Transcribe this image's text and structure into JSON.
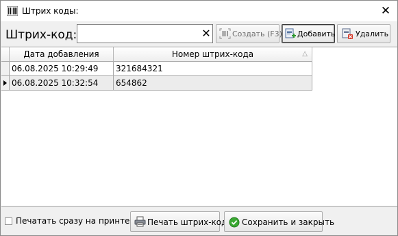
{
  "window": {
    "title": "Штрих коды:",
    "close_glyph": "✕",
    "icon": "barcode-icon"
  },
  "toolbar": {
    "barcode_label": "Штрих-код:",
    "barcode_value": "",
    "clear_glyph": "✕",
    "create_label": "Создать (F3)",
    "add_label": "Добавить",
    "delete_label": "Удалить",
    "create_enabled": false
  },
  "grid": {
    "columns": [
      "Дата добавления",
      "Номер штрих-кода"
    ],
    "sort_glyph": "△",
    "rows": [
      {
        "date": "06.08.2025 10:29:49",
        "number": "321684321",
        "current": false
      },
      {
        "date": "06.08.2025 10:32:54",
        "number": "654862",
        "current": true
      }
    ]
  },
  "footer": {
    "print_immediately_label": "Печатать сразу на принтер",
    "print_immediately_checked": false,
    "print_label": "Печать штрих-кода",
    "save_label": "Сохранить и закрыть"
  },
  "colors": {
    "window_bg": "#f0f0f0",
    "grid_bg": "#ffffff",
    "save_icon_green": "#3aa832",
    "delete_icon_red": "#d43a2a"
  }
}
